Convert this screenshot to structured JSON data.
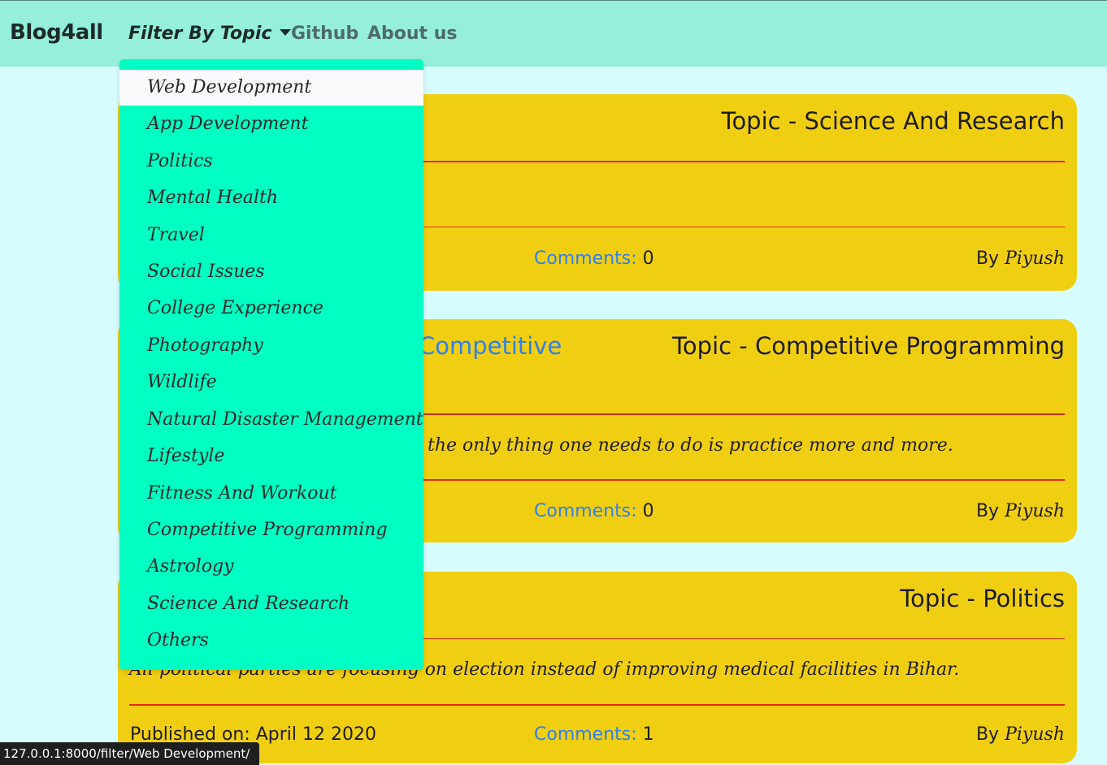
{
  "navbar": {
    "brand": "Blog4all",
    "filter_label": "Filter By Topic",
    "github_label": "Github",
    "about_label": "About us"
  },
  "dropdown": {
    "items": [
      "Web Development",
      "App Development",
      "Politics",
      "Mental Health",
      "Travel",
      "Social Issues",
      "College Experience",
      "Photography",
      "Wildlife",
      "Natural Disaster Management",
      "Lifestyle",
      "Fitness And Workout",
      "Competitive Programming",
      "Astrology",
      "Science And Research",
      "Others"
    ]
  },
  "posts": [
    {
      "topic": "Topic - Science And Research",
      "comments_label": "Comments:",
      "comments_count": "0",
      "by_label": "By",
      "author": "Piyush"
    },
    {
      "title_visible": "Competitive",
      "topic": "Topic - Competitive Programming",
      "description_visible": "the only thing one needs to do is practice more and more.",
      "comments_label": "Comments:",
      "comments_count": "0",
      "by_label": "By",
      "author": "Piyush"
    },
    {
      "topic": "Topic - Politics",
      "description_visible": "All political parties are focusing on election instead of improving medical facilities in Bihar.",
      "published": "Published on: April 12 2020",
      "comments_label": "Comments:",
      "comments_count": "1",
      "by_label": "By",
      "author": "Piyush"
    }
  ],
  "statusbar": {
    "url": "127.0.0.1:8000/filter/Web Development/"
  }
}
